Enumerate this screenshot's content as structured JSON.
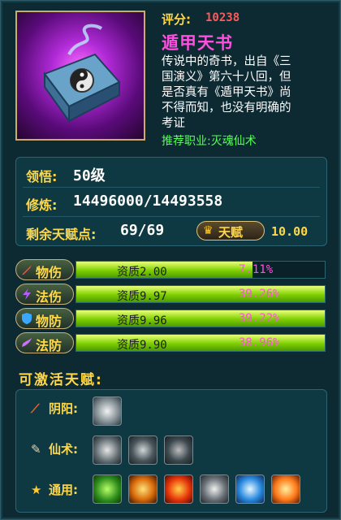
{
  "item": {
    "score_label": "评分:",
    "score_value": "10238",
    "title": "遁甲天书",
    "description_lines": [
      "传说中的奇书，出自《三",
      "国演义》第六十八回，但",
      "是否真有《遁甲天书》尚",
      "不得而知，也没有明确的",
      "考证"
    ],
    "recommend": "推荐职业:灭魂仙术"
  },
  "info": {
    "comprehension_label": "领悟:",
    "comprehension_value": "50级",
    "cultivation_label": "修炼:",
    "cultivation_value": "14496000/14493558",
    "talent_points_label": "剩余天赋点:",
    "talent_points_value": "69/69",
    "talent_button_label": "天赋",
    "talent_value": "10.00"
  },
  "stats": [
    {
      "label": "物伤",
      "quality": "资质2.00",
      "percent": "7.11%",
      "fill": 0.71,
      "icon": "sword-icon",
      "color": "#ff4a4a"
    },
    {
      "label": "法伤",
      "quality": "资质9.97",
      "percent": "39.26%",
      "fill": 1.0,
      "icon": "lightning-icon",
      "color": "#b45cff"
    },
    {
      "label": "物防",
      "quality": "资质9.96",
      "percent": "39.22%",
      "fill": 1.0,
      "icon": "shield-icon",
      "color": "#3aa8ff"
    },
    {
      "label": "法防",
      "quality": "资质9.90",
      "percent": "38.96%",
      "fill": 1.0,
      "icon": "magic-shield-icon",
      "color": "#c870ff"
    }
  ],
  "talents": {
    "title": "可激活天赋:",
    "groups": [
      {
        "label": "阴阳:",
        "icon": "whip-icon",
        "skills": [
          "swirl-skill-icon"
        ]
      },
      {
        "label": "仙术:",
        "icon": "fan-icon",
        "skills": [
          "wind-skill-icon",
          "vortex-skill-icon",
          "dragon-skill-icon"
        ]
      },
      {
        "label": "通用:",
        "icon": "star-icon",
        "skills": [
          "warrior-skill-icon",
          "flame-aura-skill-icon",
          "fire-skill-icon",
          "beast-skill-icon",
          "meditation-skill-icon",
          "burst-skill-icon"
        ]
      }
    ]
  },
  "colors": {
    "gold": "#ffd84a",
    "pink": "#ff4fe0",
    "score_red": "#ff5a5a",
    "recommend_green": "#55ff55",
    "bar_green": "#7dcf00"
  }
}
